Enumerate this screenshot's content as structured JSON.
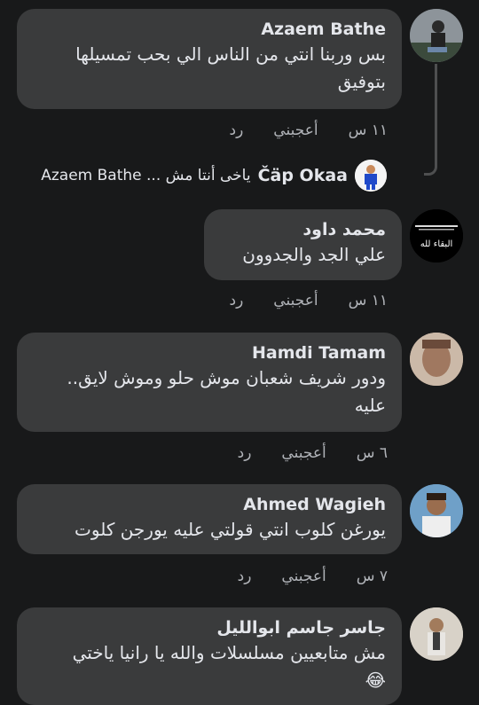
{
  "comments": [
    {
      "author": "Azaem Bathe",
      "line1": "بس وربنا انتي من الناس الي بحب تمسيلها",
      "line2": "بتوفيق",
      "time": "١١ س",
      "like": "أعجبني",
      "reply": "رد"
    },
    {
      "author": "محمد داود",
      "line1": "علي الجد والجدوون",
      "time": "١١ س",
      "like": "أعجبني",
      "reply": "رد",
      "avatar_caption": "البقاء لله"
    },
    {
      "author": "Hamdi Tamam",
      "line1": "ودور شريف شعبان موش حلو وموش لايق..",
      "line2": "عليه",
      "time": "٦ س",
      "like": "أعجبني",
      "reply": "رد"
    },
    {
      "author": "Ahmed Wagieh",
      "line1": "يورغن كلوب انتي قولتي عليه يورجن كلوت",
      "time": "٧ س",
      "like": "أعجبني",
      "reply": "رد"
    },
    {
      "author": "جاسر جاسم ابوالليل",
      "line1": "مش متابعيين مسلسلات والله يا رانيا ياختي",
      "line2_emoji": "😂"
    }
  ],
  "reply_preview": {
    "author": "Čäp Okaa",
    "text": "ياخى أنتا مش ... Azaem Bathe"
  }
}
